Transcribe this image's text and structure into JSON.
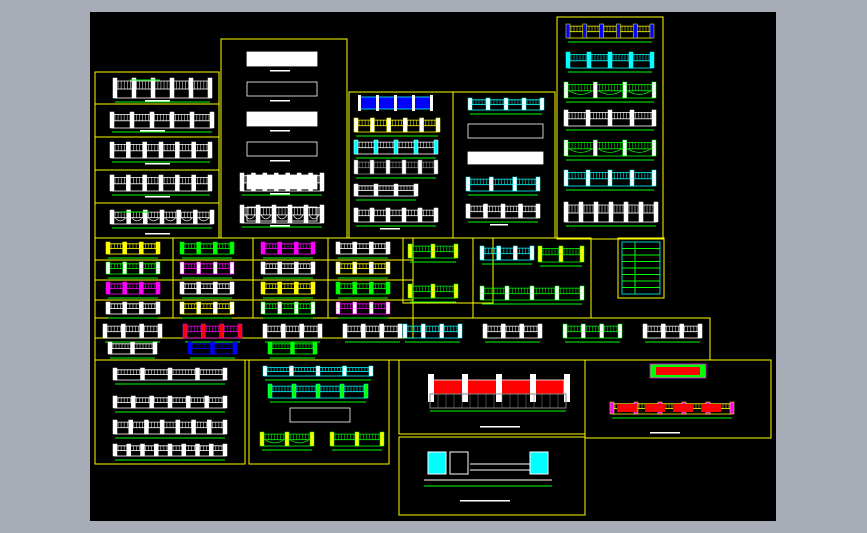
{
  "window": {
    "background": "#a7acb6"
  },
  "cad": {
    "background": "#000000",
    "frame_color": "#ffff00",
    "colors": {
      "white": "#ffffff",
      "green": "#00ff00",
      "cyan": "#00ffff",
      "blue": "#0000ff",
      "yellow": "#ffff00",
      "magenta": "#ff00ff",
      "red": "#ff0000",
      "gray": "#888888"
    },
    "title_text": ""
  }
}
